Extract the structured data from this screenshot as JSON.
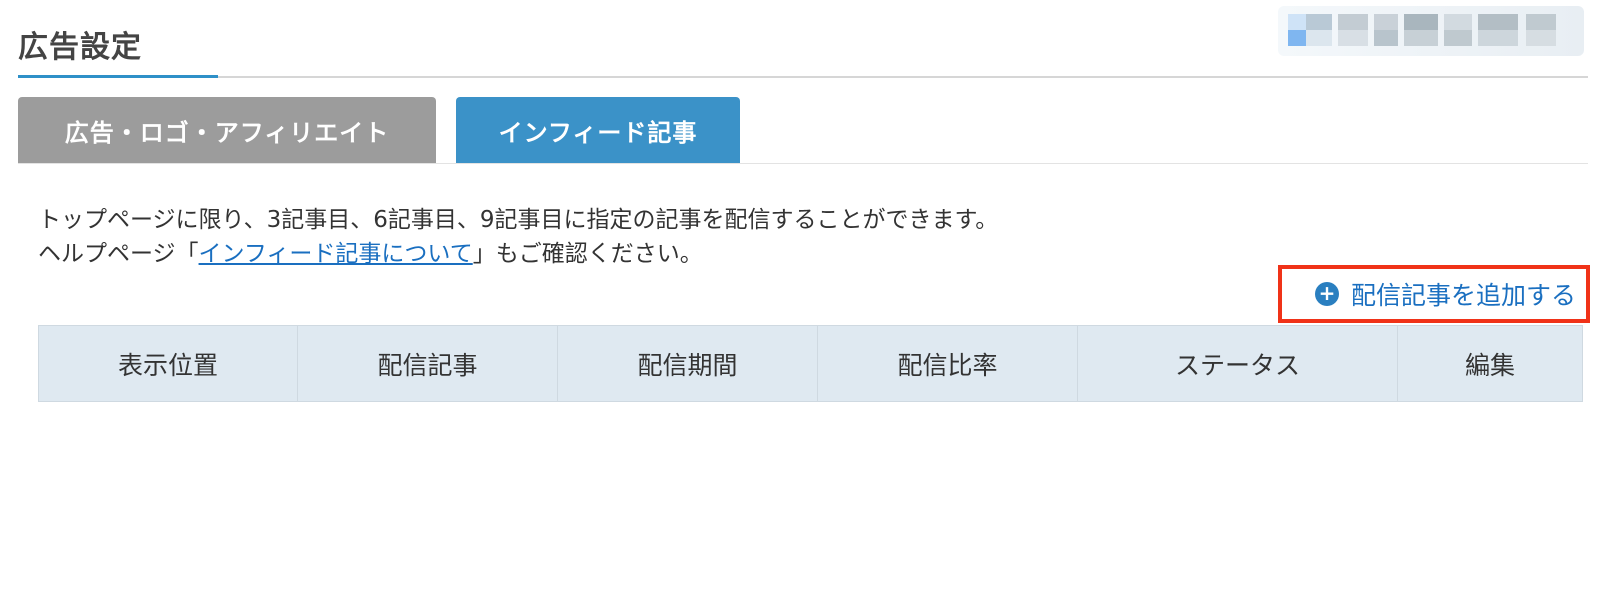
{
  "page": {
    "title": "広告設定"
  },
  "tabs": [
    {
      "label": "広告・ロゴ・アフィリエイト",
      "active": false
    },
    {
      "label": "インフィード記事",
      "active": true
    }
  ],
  "description": {
    "line1": "トップページに限り、3記事目、6記事目、9記事目に指定の記事を配信することができます。",
    "line2_prefix": "ヘルプページ「",
    "line2_link": "インフィード記事について",
    "line2_suffix": "」もご確認ください。"
  },
  "actions": {
    "add_article_label": "配信記事を追加する",
    "add_icon": "plus-circle-icon"
  },
  "table": {
    "columns": [
      "表示位置",
      "配信記事",
      "配信期間",
      "配信比率",
      "ステータス",
      "編集"
    ],
    "rows": []
  },
  "colors": {
    "accent": "#2e90c8",
    "tab_inactive": "#9c9c9c",
    "tab_active": "#3b92c8",
    "link": "#1a6fc0",
    "highlight_border": "#f03218",
    "table_header_bg": "#dfe9f1"
  }
}
